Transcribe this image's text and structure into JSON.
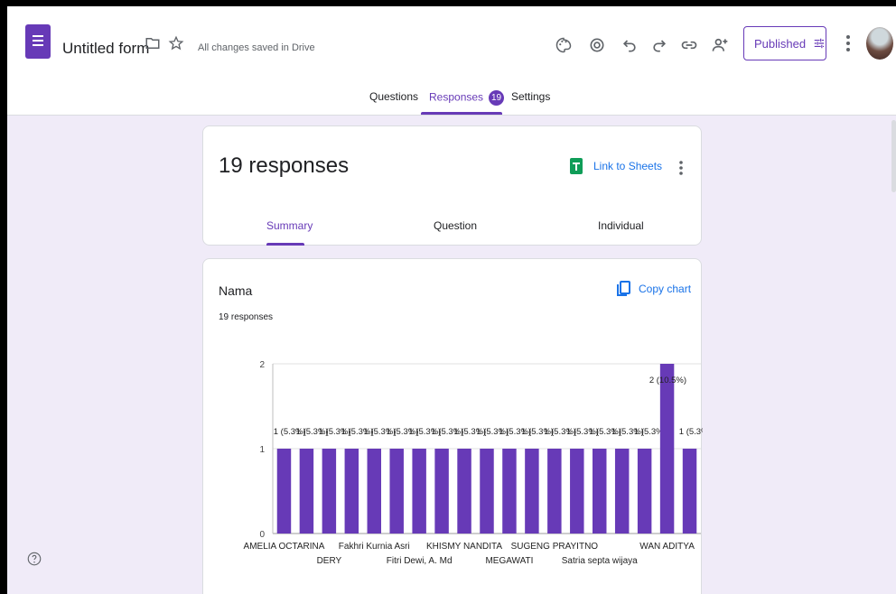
{
  "header": {
    "form_title": "Untitled form",
    "saved_status": "All changes saved in Drive",
    "published_label": "Published",
    "tools": [
      "palette-icon",
      "preview-icon",
      "undo-icon",
      "redo-icon",
      "link-icon",
      "add-collaborator-icon"
    ]
  },
  "tabs": {
    "questions": "Questions",
    "responses": "Responses",
    "responses_count": "19",
    "settings": "Settings"
  },
  "summary_card": {
    "title": "19 responses",
    "link_sheets": "Link to Sheets",
    "subtabs": {
      "summary": "Summary",
      "question": "Question",
      "individual": "Individual"
    }
  },
  "question_card": {
    "title": "Nama",
    "subtitle": "19 responses",
    "copy_chart": "Copy chart"
  },
  "colors": {
    "accent": "#673ab7",
    "bar": "#673ab7",
    "link": "#1a73e8"
  },
  "chart_data": {
    "type": "bar",
    "ylim": [
      0,
      2
    ],
    "yticks": [
      0,
      1,
      2
    ],
    "values": [
      1,
      1,
      1,
      1,
      1,
      1,
      1,
      1,
      1,
      1,
      1,
      1,
      1,
      1,
      1,
      1,
      1,
      2,
      1
    ],
    "data_labels": [
      "1 (5.3%)",
      "1 (5.3%)",
      "1 (5.3%)",
      "1 (5.3%)",
      "1 (5.3%)",
      "1 (5.3%)",
      "1 (5.3%)",
      "1 (5.3%)",
      "1 (5.3%)",
      "1 (5.3%)",
      "1 (5.3%)",
      "1 (5.3%)",
      "1 (5.3%)",
      "1 (5.3%)",
      "1 (5.3%)",
      "1 (5.3%)",
      "1 (5.3%)",
      "2 (10.5%)",
      "1 (5.3%"
    ],
    "visible_category_labels": [
      {
        "index": 0,
        "label": "AMELIA OCTARINA",
        "row": 0
      },
      {
        "index": 2,
        "label": "DERY",
        "row": 1
      },
      {
        "index": 4,
        "label": "Fakhri Kurnia Asri",
        "row": 0
      },
      {
        "index": 6,
        "label": "Fitri Dewi, A. Md",
        "row": 1
      },
      {
        "index": 8,
        "label": "KHISMY NANDITA",
        "row": 0
      },
      {
        "index": 10,
        "label": "MEGAWATI",
        "row": 1
      },
      {
        "index": 12,
        "label": "SUGENG PRAYITNO",
        "row": 0
      },
      {
        "index": 14,
        "label": "Satria septa wijaya",
        "row": 1
      },
      {
        "index": 17,
        "label": "WAN ADITYA",
        "row": 0
      }
    ]
  }
}
